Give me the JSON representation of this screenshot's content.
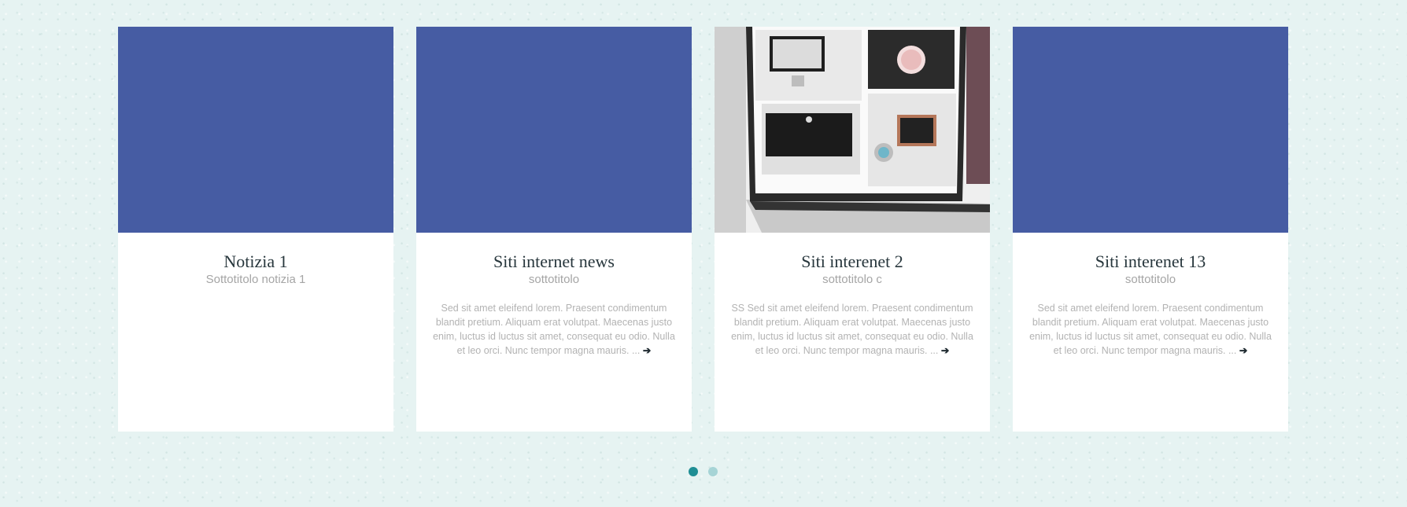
{
  "cards": [
    {
      "title": "Notizia 1",
      "subtitle": "Sottotitolo notizia 1",
      "text": "",
      "read_more": ""
    },
    {
      "title": "Siti internet news",
      "subtitle": "sottotitolo",
      "text": "Sed sit amet eleifend lorem. Praesent condimentum blandit pretium. Aliquam erat volutpat. Maecenas justo enim, luctus id luctus sit amet, consequat eu odio. Nulla et leo orci. Nunc tempor magna mauris. ...",
      "read_more": "➔"
    },
    {
      "title": "Siti interenet 2",
      "subtitle": "sottotitolo c",
      "text": "SS Sed sit amet eleifend lorem. Praesent condimentum blandit pretium. Aliquam erat volutpat. Maecenas justo enim, luctus id luctus sit amet, consequat eu odio. Nulla et leo orci. Nunc tempor magna mauris. ...",
      "read_more": "➔"
    },
    {
      "title": "Siti interenet 13",
      "subtitle": "sottotitolo",
      "text": "Sed sit amet eleifend lorem. Praesent condimentum blandit pretium. Aliquam erat volutpat. Maecenas justo enim, luctus id luctus sit amet, consequat eu odio. Nulla et leo orci. Nunc tempor magna mauris. ...",
      "read_more": "➔"
    }
  ],
  "colors": {
    "placeholder_image": "#465ca3",
    "dot_active": "#1f8e94",
    "dot_inactive": "#a6d4d6",
    "background": "#e6f3f2"
  },
  "pagination": {
    "pages": 2,
    "current": 1
  }
}
